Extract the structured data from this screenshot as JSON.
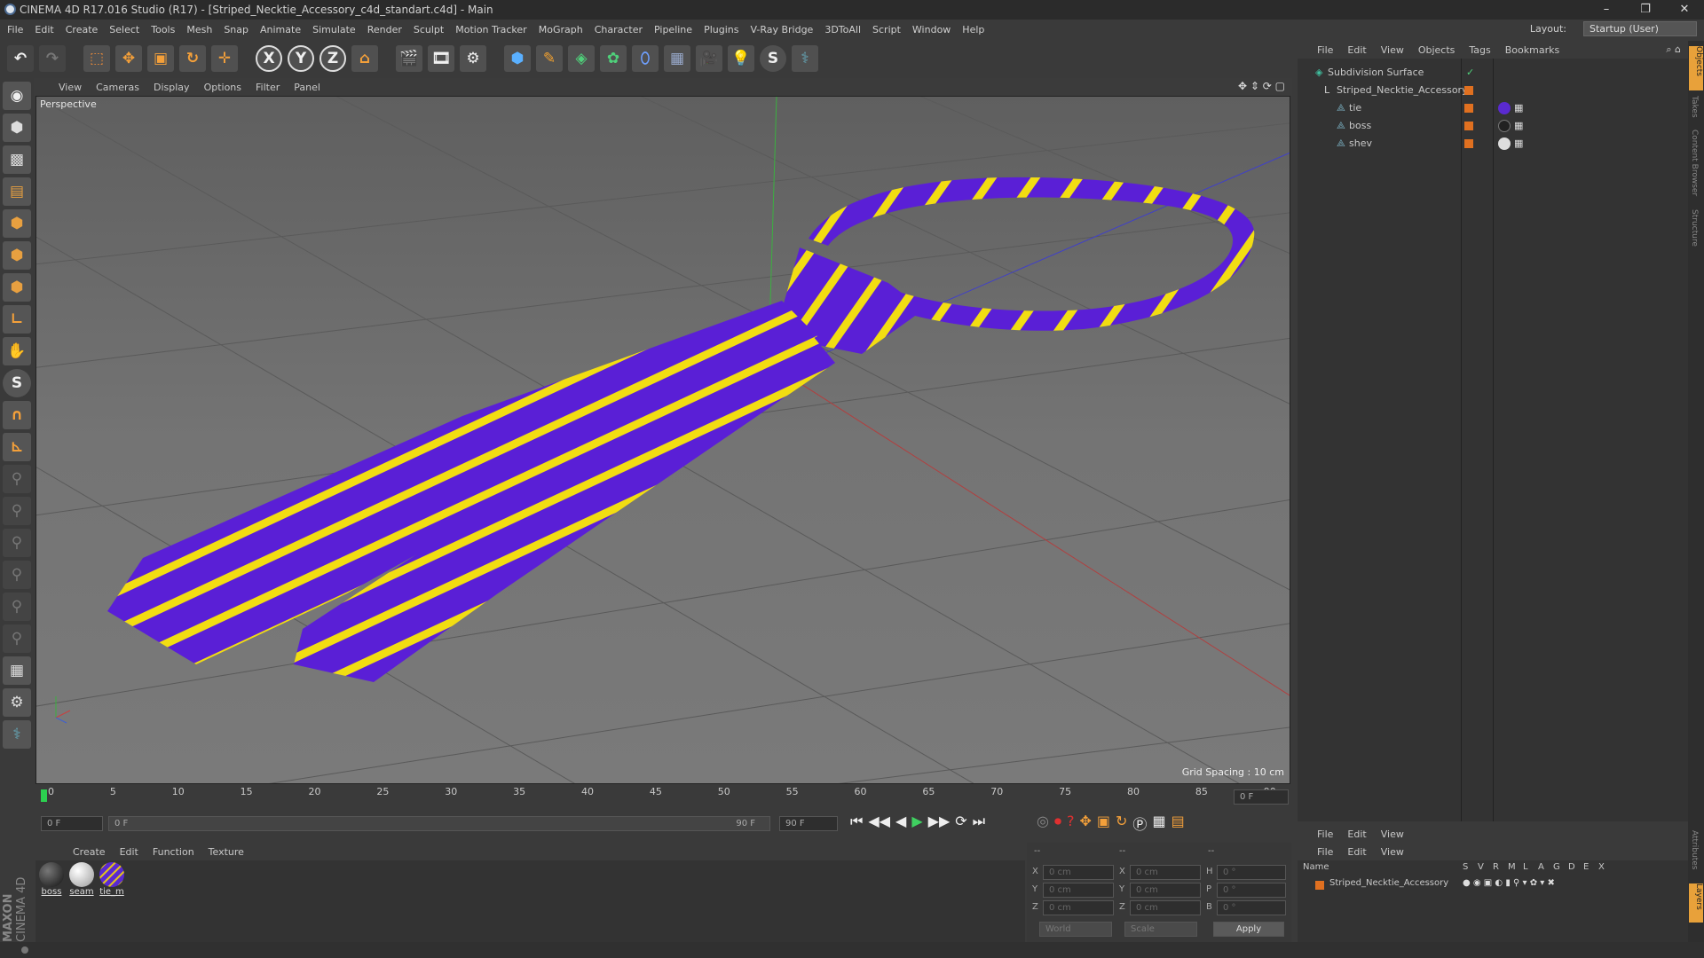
{
  "window": {
    "title": "CINEMA 4D R17.016 Studio (R17) - [Striped_Necktie_Accessory_c4d_standart.c4d] - Main",
    "minimize": "–",
    "maximize": "❐",
    "close": "✕"
  },
  "menubar": {
    "items": [
      "File",
      "Edit",
      "Create",
      "Select",
      "Tools",
      "Mesh",
      "Snap",
      "Animate",
      "Simulate",
      "Render",
      "Sculpt",
      "Motion Tracker",
      "MoGraph",
      "Character",
      "Pipeline",
      "Plugins",
      "V-Ray Bridge",
      "3DToAll",
      "Script",
      "Window",
      "Help"
    ]
  },
  "layout": {
    "label": "Layout:",
    "value": "Startup (User)"
  },
  "viewport": {
    "menu": [
      "View",
      "Cameras",
      "Display",
      "Options",
      "Filter",
      "Panel"
    ],
    "label": "Perspective",
    "grid_spacing": "Grid Spacing : 10 cm"
  },
  "timeline": {
    "ticks": [
      "0",
      "5",
      "10",
      "15",
      "20",
      "25",
      "30",
      "35",
      "40",
      "45",
      "50",
      "55",
      "60",
      "65",
      "70",
      "75",
      "80",
      "85",
      "90"
    ],
    "current_frame": "0 F",
    "start_field": "0 F",
    "range_start": "0 F",
    "range_end": "90 F",
    "end_field": "90 F"
  },
  "material_manager": {
    "menu": [
      "Create",
      "Edit",
      "Function",
      "Texture"
    ],
    "materials": [
      {
        "name": "boss",
        "color": "#222222"
      },
      {
        "name": "seam",
        "color": "#d8d8d8"
      },
      {
        "name": "tie_m",
        "color": "#5a2ad0"
      }
    ]
  },
  "coordinates": {
    "rows": [
      {
        "axis": "X",
        "pos": "0 cm",
        "axis2": "X",
        "size": "0 cm",
        "rot_axis": "H",
        "rot": "0 °"
      },
      {
        "axis": "Y",
        "pos": "0 cm",
        "axis2": "Y",
        "size": "0 cm",
        "rot_axis": "P",
        "rot": "0 °"
      },
      {
        "axis": "Z",
        "pos": "0 cm",
        "axis2": "Z",
        "size": "0 cm",
        "rot_axis": "B",
        "rot": "0 °"
      }
    ],
    "space": "World",
    "mode": "Scale",
    "apply": "Apply",
    "header_dashes": [
      "--",
      "--",
      "--"
    ]
  },
  "object_manager": {
    "menu": [
      "File",
      "Edit",
      "View",
      "Objects",
      "Tags",
      "Bookmarks"
    ],
    "objects": [
      {
        "name": "Subdivision Surface",
        "indent": 0
      },
      {
        "name": "Striped_Necktie_Accessory",
        "indent": 1
      },
      {
        "name": "tie",
        "indent": 2
      },
      {
        "name": "boss",
        "indent": 2
      },
      {
        "name": "shev",
        "indent": 2
      }
    ]
  },
  "layer_manager": {
    "menu": [
      "File",
      "Edit",
      "View"
    ],
    "columns": [
      "Name",
      "S",
      "V",
      "R",
      "M",
      "L",
      "A",
      "G",
      "D",
      "E",
      "X"
    ],
    "layers": [
      {
        "name": "Striped_Necktie_Accessory"
      }
    ]
  },
  "side_tabs": [
    "Objects",
    "Takes",
    "Content Browser",
    "Structure",
    "Attributes",
    "Layers"
  ],
  "brand": {
    "line1": "MAXON",
    "line2": "CINEMA 4D"
  },
  "colors": {
    "tie_purple": "#5a1fd6",
    "tie_yellow": "#f2dd12",
    "accent_orange": "#e07020"
  }
}
